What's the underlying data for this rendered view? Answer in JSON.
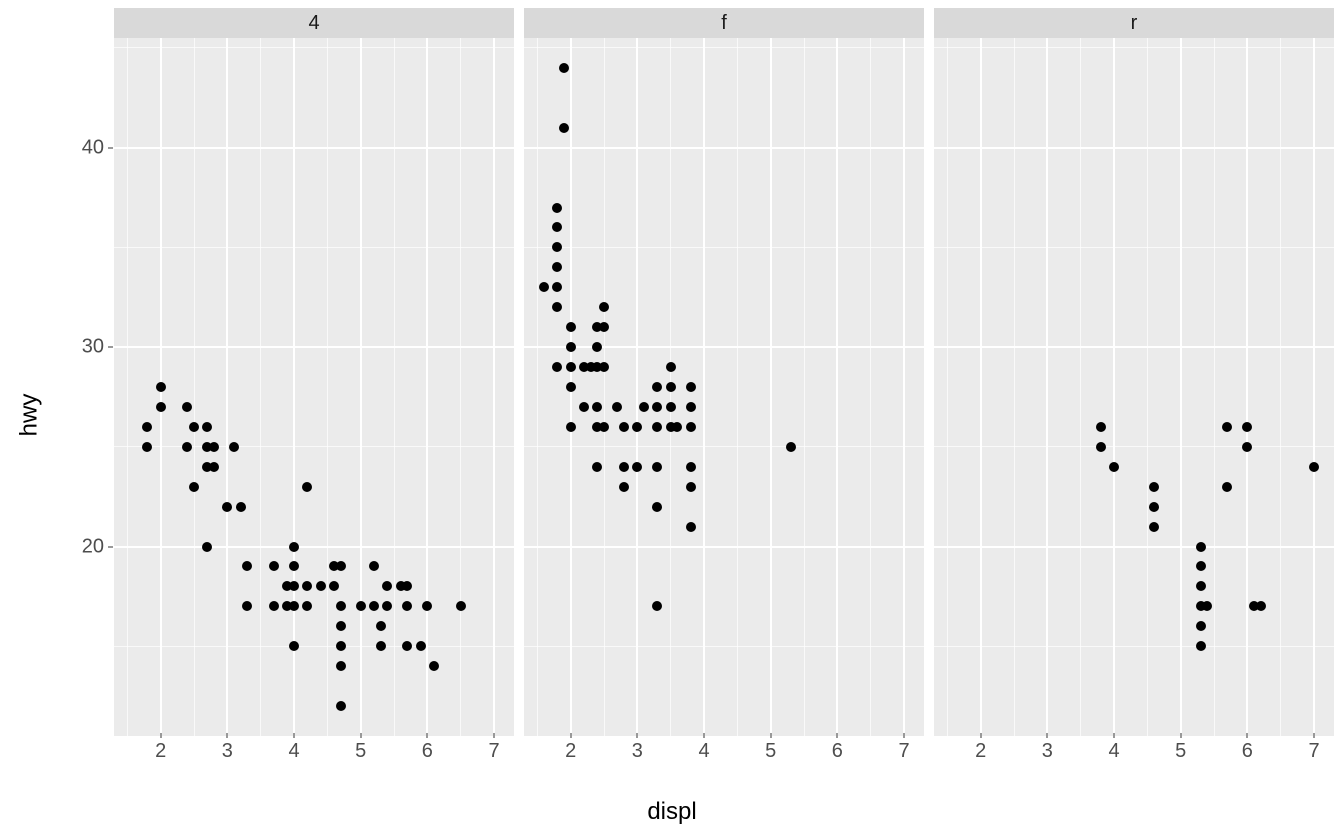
{
  "chart_data": {
    "type": "scatter",
    "facets": [
      "4",
      "f",
      "r"
    ],
    "xlabel": "displ",
    "ylabel": "hwy",
    "xlim": [
      1.3,
      7.3
    ],
    "ylim": [
      10.5,
      45.5
    ],
    "x_ticks": [
      2,
      3,
      4,
      5,
      6,
      7
    ],
    "y_ticks": [
      20,
      30,
      40
    ],
    "x_minor": [
      1.5,
      2.5,
      3.5,
      4.5,
      5.5,
      6.5
    ],
    "y_minor": [
      15,
      25,
      35,
      45
    ],
    "series": [
      {
        "name": "4",
        "points": [
          [
            1.8,
            26
          ],
          [
            1.8,
            25
          ],
          [
            2.0,
            28
          ],
          [
            2.0,
            27
          ],
          [
            2.8,
            24
          ],
          [
            2.8,
            25
          ],
          [
            3.1,
            25
          ],
          [
            2.4,
            27
          ],
          [
            2.4,
            25
          ],
          [
            2.5,
            26
          ],
          [
            2.5,
            23
          ],
          [
            2.7,
            24
          ],
          [
            2.7,
            25
          ],
          [
            2.7,
            26
          ],
          [
            3.0,
            22
          ],
          [
            3.2,
            22
          ],
          [
            3.3,
            19
          ],
          [
            3.3,
            17
          ],
          [
            3.7,
            19
          ],
          [
            3.7,
            17
          ],
          [
            3.9,
            17
          ],
          [
            3.9,
            18
          ],
          [
            4.0,
            20
          ],
          [
            4.0,
            19
          ],
          [
            4.0,
            18
          ],
          [
            4.0,
            17
          ],
          [
            4.2,
            17
          ],
          [
            4.2,
            18
          ],
          [
            4.4,
            18
          ],
          [
            4.6,
            19
          ],
          [
            4.6,
            18
          ],
          [
            4.7,
            17
          ],
          [
            4.7,
            19
          ],
          [
            4.7,
            16
          ],
          [
            4.7,
            15
          ],
          [
            4.7,
            14
          ],
          [
            4.7,
            12
          ],
          [
            5.0,
            17
          ],
          [
            5.2,
            17
          ],
          [
            5.2,
            19
          ],
          [
            5.3,
            15
          ],
          [
            5.3,
            16
          ],
          [
            5.4,
            17
          ],
          [
            5.4,
            18
          ],
          [
            5.6,
            18
          ],
          [
            5.7,
            17
          ],
          [
            5.7,
            18
          ],
          [
            5.7,
            15
          ],
          [
            5.9,
            15
          ],
          [
            6.0,
            17
          ],
          [
            6.1,
            14
          ],
          [
            6.5,
            17
          ],
          [
            4.0,
            15
          ],
          [
            4.2,
            23
          ],
          [
            2.7,
            20
          ]
        ]
      },
      {
        "name": "f",
        "points": [
          [
            1.6,
            33
          ],
          [
            1.8,
            36
          ],
          [
            1.8,
            35
          ],
          [
            1.8,
            37
          ],
          [
            1.8,
            34
          ],
          [
            1.8,
            33
          ],
          [
            1.8,
            32
          ],
          [
            1.8,
            29
          ],
          [
            1.9,
            44
          ],
          [
            1.9,
            41
          ],
          [
            2.0,
            29
          ],
          [
            2.0,
            30
          ],
          [
            2.0,
            31
          ],
          [
            2.0,
            28
          ],
          [
            2.0,
            26
          ],
          [
            2.2,
            27
          ],
          [
            2.2,
            29
          ],
          [
            2.3,
            29
          ],
          [
            2.4,
            30
          ],
          [
            2.4,
            31
          ],
          [
            2.4,
            29
          ],
          [
            2.4,
            27
          ],
          [
            2.4,
            26
          ],
          [
            2.4,
            24
          ],
          [
            2.5,
            32
          ],
          [
            2.5,
            31
          ],
          [
            2.5,
            29
          ],
          [
            2.5,
            26
          ],
          [
            2.7,
            27
          ],
          [
            2.8,
            26
          ],
          [
            2.8,
            23
          ],
          [
            2.8,
            24
          ],
          [
            3.0,
            26
          ],
          [
            3.0,
            24
          ],
          [
            3.1,
            27
          ],
          [
            3.3,
            28
          ],
          [
            3.3,
            27
          ],
          [
            3.3,
            26
          ],
          [
            3.3,
            22
          ],
          [
            3.3,
            24
          ],
          [
            3.3,
            17
          ],
          [
            3.5,
            29
          ],
          [
            3.5,
            28
          ],
          [
            3.5,
            27
          ],
          [
            3.5,
            26
          ],
          [
            3.6,
            26
          ],
          [
            3.8,
            26
          ],
          [
            3.8,
            28
          ],
          [
            3.8,
            27
          ],
          [
            3.8,
            24
          ],
          [
            3.8,
            23
          ],
          [
            3.8,
            21
          ],
          [
            5.3,
            25
          ]
        ]
      },
      {
        "name": "r",
        "points": [
          [
            3.8,
            26
          ],
          [
            3.8,
            25
          ],
          [
            4.0,
            24
          ],
          [
            4.6,
            23
          ],
          [
            4.6,
            22
          ],
          [
            4.6,
            21
          ],
          [
            5.3,
            19
          ],
          [
            5.3,
            20
          ],
          [
            5.3,
            18
          ],
          [
            5.3,
            17
          ],
          [
            5.3,
            16
          ],
          [
            5.3,
            15
          ],
          [
            5.4,
            17
          ],
          [
            5.7,
            26
          ],
          [
            5.7,
            23
          ],
          [
            6.0,
            25
          ],
          [
            6.0,
            26
          ],
          [
            6.1,
            17
          ],
          [
            6.2,
            17
          ],
          [
            7.0,
            24
          ]
        ]
      }
    ]
  }
}
